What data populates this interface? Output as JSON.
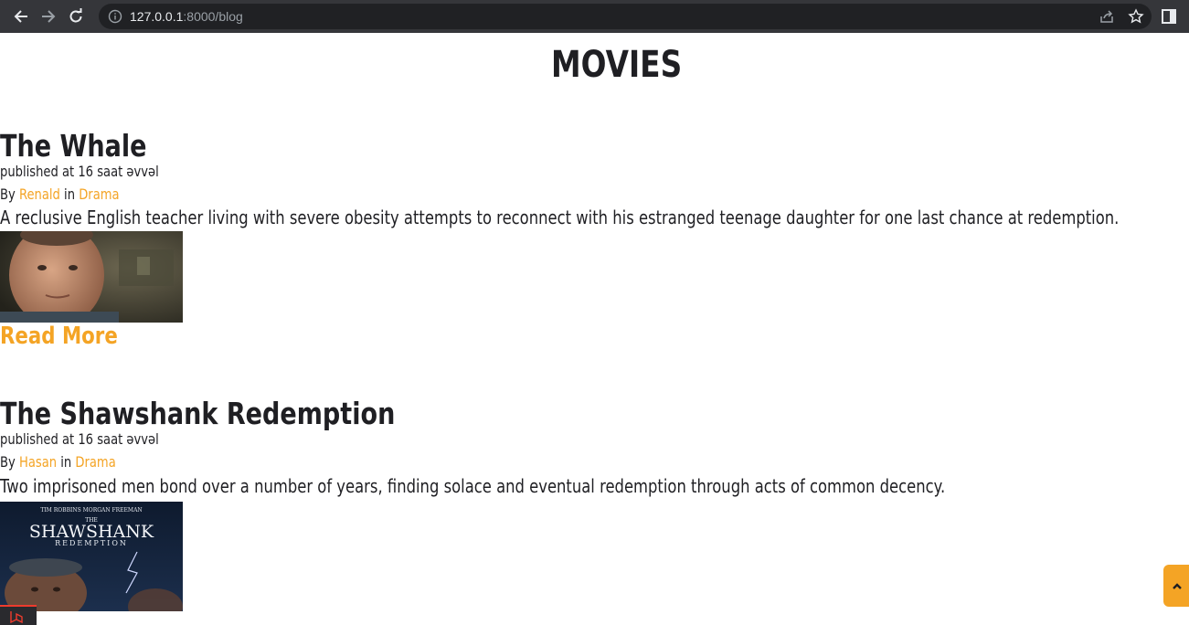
{
  "browser": {
    "url_host": "127.0.0.1",
    "url_path": ":8000/blog"
  },
  "page": {
    "title": "MOVIES",
    "by_label": "By",
    "in_label": "in",
    "read_more_label": "Read More"
  },
  "posts": [
    {
      "title": "The Whale",
      "published": "published at 16 saat əvvəl",
      "author": "Renald",
      "category": "Drama",
      "description": "A reclusive English teacher living with severe obesity attempts to reconnect with his estranged teenage daughter for one last chance at redemption."
    },
    {
      "title": "The Shawshank Redemption",
      "published": "published at 16 saat əvvəl",
      "author": "Hasan",
      "category": "Drama",
      "description": "Two imprisoned men bond over a number of years, finding solace and eventual redemption through acts of common decency.",
      "poster_credits": "TIM ROBBINS   MORGAN FREEMAN",
      "poster_the": "THE",
      "poster_title": "SHAWSHANK",
      "poster_subtitle": "REDEMPTION"
    }
  ],
  "colors": {
    "accent": "#f4a425",
    "text": "#1f1f23",
    "chrome": "#35363a"
  }
}
